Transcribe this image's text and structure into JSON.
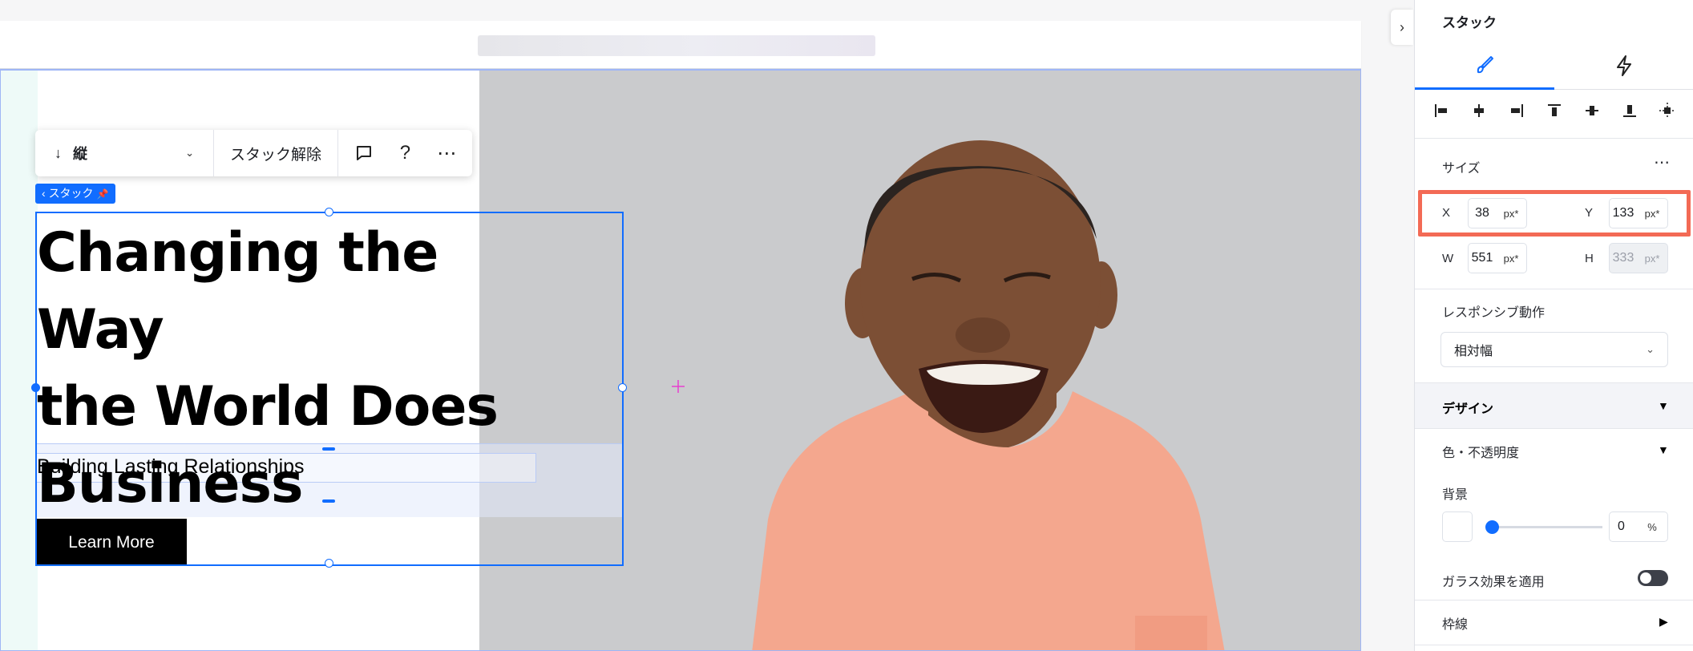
{
  "toolbar": {
    "direction_label": "縦",
    "unstack_label": "スタック解除"
  },
  "stack_tag": {
    "label": "スタック"
  },
  "hero": {
    "headline_line1": "Changing the Way",
    "headline_line2": "the World Does",
    "headline_line3": "Business",
    "subheadline": "Building Lasting Relationships",
    "button_label": "Learn More"
  },
  "panel": {
    "title": "スタック",
    "size": {
      "label": "サイズ",
      "x_label": "X",
      "x_value": "38",
      "x_unit": "px*",
      "y_label": "Y",
      "y_value": "133",
      "y_unit": "px*",
      "w_label": "W",
      "w_value": "551",
      "w_unit": "px*",
      "h_label": "H",
      "h_value": "333",
      "h_unit": "px*"
    },
    "responsive": {
      "label": "レスポンシブ動作",
      "value": "相対幅"
    },
    "design": {
      "label": "デザイン",
      "color_opacity_label": "色・不透明度",
      "background_label": "背景",
      "opacity_value": "0",
      "opacity_unit": "%",
      "glass_label": "ガラス効果を適用",
      "border_label": "枠線"
    }
  },
  "colors": {
    "accent": "#116dff",
    "highlight": "#f36a55",
    "shirt": "#f4a78e"
  }
}
